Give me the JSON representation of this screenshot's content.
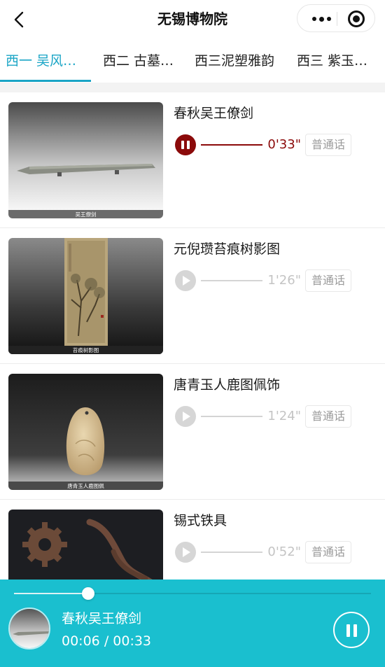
{
  "nav": {
    "title": "无锡博物院",
    "back_icon": "chevron-left-icon",
    "more_icon": "more-dots-icon",
    "close_icon": "target-circle-icon"
  },
  "tabs": [
    {
      "label": "西一 吴风…",
      "active": true
    },
    {
      "label": "西二 古墓…",
      "active": false
    },
    {
      "label": "西三泥塑雅韵",
      "active": false
    },
    {
      "label": "西三 紫玉…",
      "active": false
    }
  ],
  "colors": {
    "accent": "#1aa5c6",
    "player_bg": "#1abfcf",
    "playing": "#8b0a0a"
  },
  "items": [
    {
      "title": "春秋吴王僚剑",
      "duration": "0'33\"",
      "lang": "普通话",
      "playing": true,
      "caption": "吴王僚剑",
      "play_icon": "pause-icon"
    },
    {
      "title": "元倪瓒苔痕树影图",
      "duration": "1'26\"",
      "lang": "普通话",
      "playing": false,
      "caption": "苔痕树影图",
      "play_icon": "play-icon"
    },
    {
      "title": "唐青玉人鹿图佩饰",
      "duration": "1'24\"",
      "lang": "普通话",
      "playing": false,
      "caption": "唐青玉人鹿图佩",
      "play_icon": "play-icon"
    },
    {
      "title": "锡式铁具",
      "duration": "0'52\"",
      "lang": "普通话",
      "playing": false,
      "caption": "",
      "play_icon": "play-icon"
    }
  ],
  "player": {
    "title": "春秋吴王僚剑",
    "current": "00:06",
    "separator": "/",
    "total": "00:33",
    "progress": 0.208,
    "pause_icon": "pause-icon"
  }
}
